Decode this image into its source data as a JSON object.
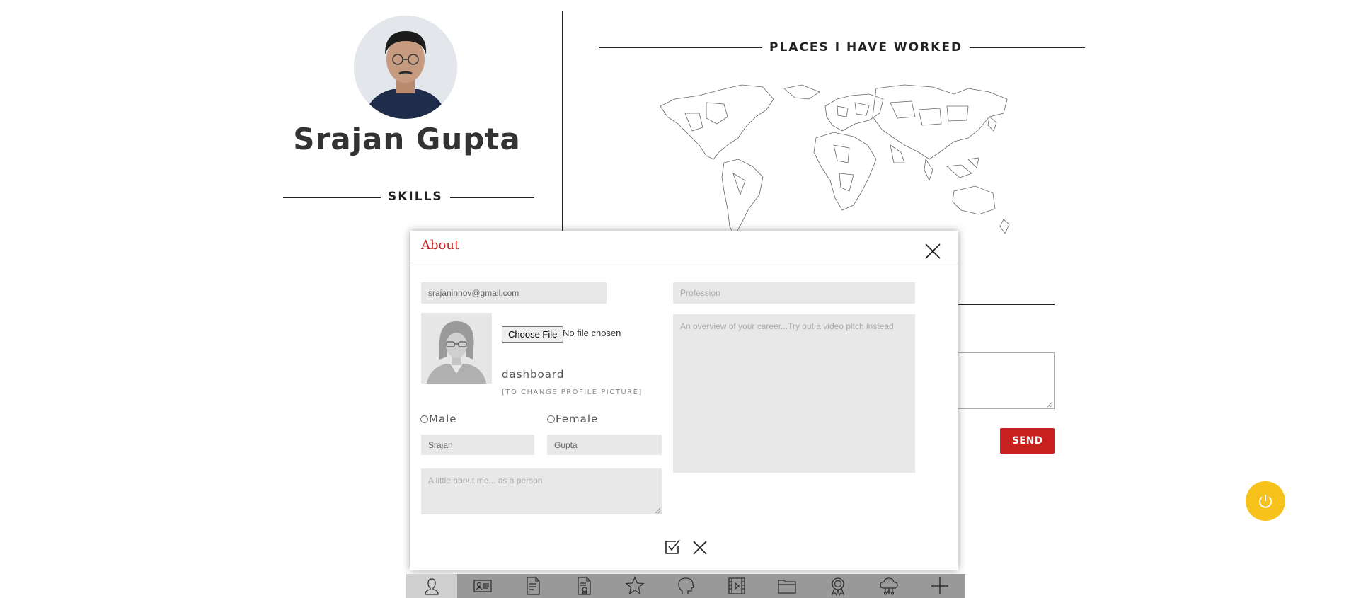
{
  "profile": {
    "name": "Srajan Gupta",
    "skills_heading": "SKILLS"
  },
  "places": {
    "heading": "PLACES I HAVE WORKED"
  },
  "contact": {
    "send_label": "SEND"
  },
  "modal": {
    "title": "About",
    "email_value": "srajaninnov@gmail.com",
    "profession_placeholder": "Profession",
    "overview_placeholder": "An overview of your career...Try out a video pitch instead",
    "choose_file_label": "Choose File",
    "no_file_text": "No file chosen",
    "dashboard_label": "dashboard",
    "change_picture_label": "[TO CHANGE PROFILE PICTURE]",
    "gender_options": [
      "Male",
      "Female"
    ],
    "first_name_value": "Srajan",
    "last_name_value": "Gupta",
    "about_placeholder": "A little about me... as a person"
  },
  "toolbar": {
    "items": [
      "user-icon",
      "id-card-icon",
      "resume-icon",
      "certificate-doc-icon",
      "star-icon",
      "head-icon",
      "film-icon",
      "folder-icon",
      "award-icon",
      "cloud-icon",
      "plus-icon"
    ],
    "active_index": 0
  },
  "colors": {
    "accent_red": "#c8201f",
    "power_yellow": "#f7c21b",
    "toolbar_gray": "#999999",
    "field_gray": "#e8e8e8"
  }
}
